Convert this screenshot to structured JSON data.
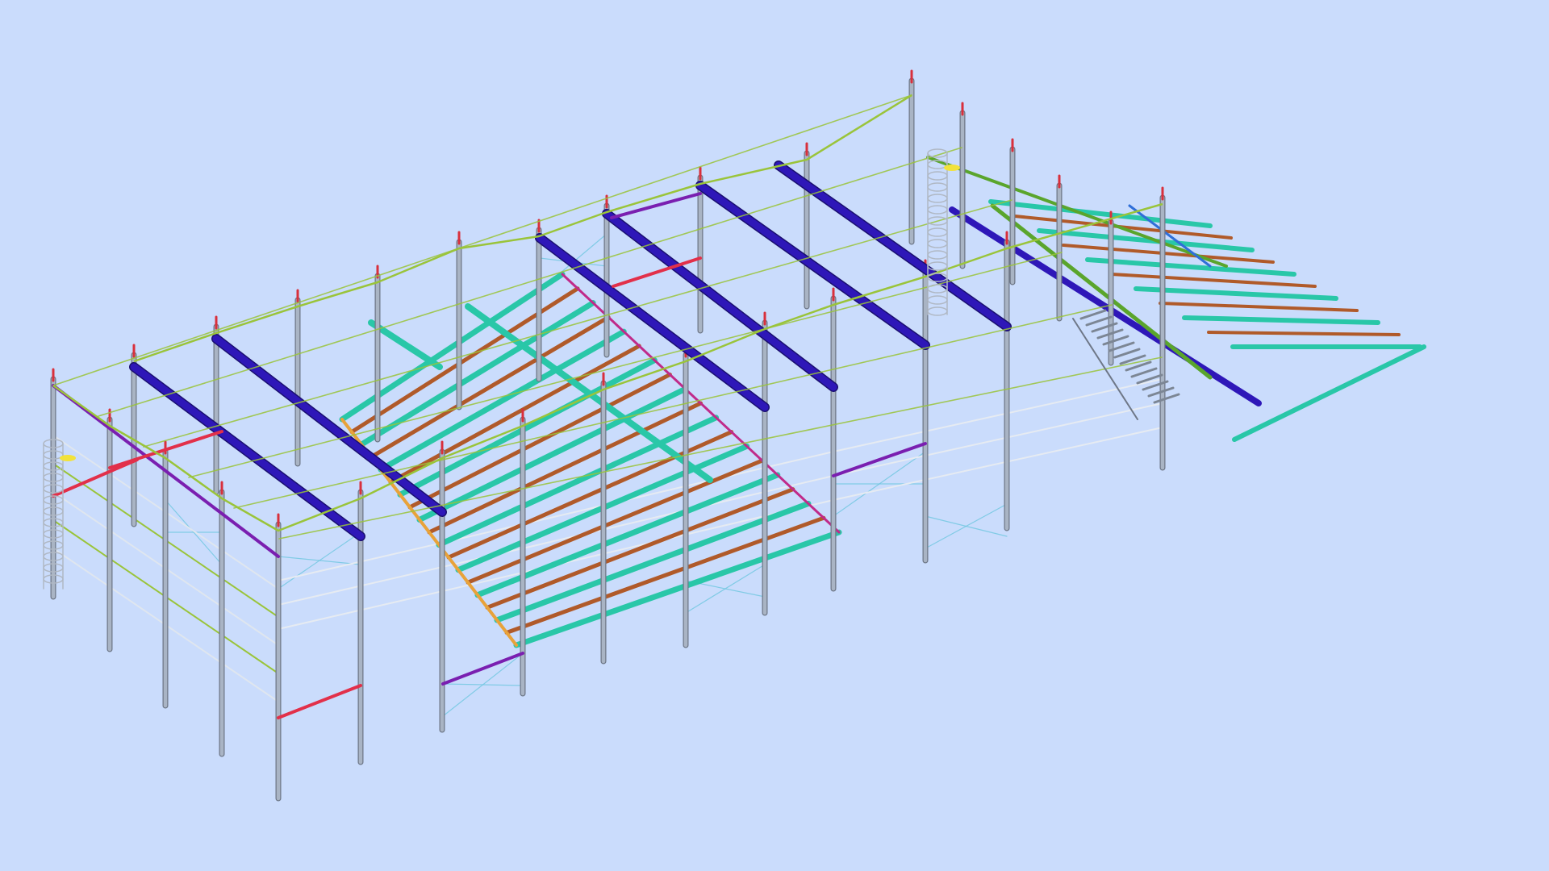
{
  "viewport": {
    "background": "#cadcfc",
    "view": "isometric",
    "model_type": "steel frame building"
  },
  "colors": {
    "column": "#a9b4c4",
    "column_edge": "#6e7787",
    "rafter_main": "#2e17b8",
    "rafter_secondary": "#7a1fb0",
    "floor_joist": "#29c7a8",
    "floor_beam": "#b05a2a",
    "purlin": "#9ac43a",
    "eave_beam": "#e2304a",
    "column_cap": "#d8303c",
    "edge_beam": "#e8a23a",
    "stair": "#7c8694",
    "bracing": "#6fc7e0",
    "cage": "#b0b8c4",
    "hatch_marker": "#f2e23a",
    "green_beam": "#5aa52c",
    "magenta_beam": "#c02a8a",
    "blue_beam": "#2f6fd8"
  },
  "model": {
    "name": "",
    "levels": [
      "ground",
      "mezzanine",
      "roof"
    ],
    "features": [
      "columns",
      "rafters",
      "purlins",
      "mezzanine-floor-left",
      "mezzanine-floor-right",
      "stair",
      "ladder-cages",
      "bracing"
    ]
  }
}
